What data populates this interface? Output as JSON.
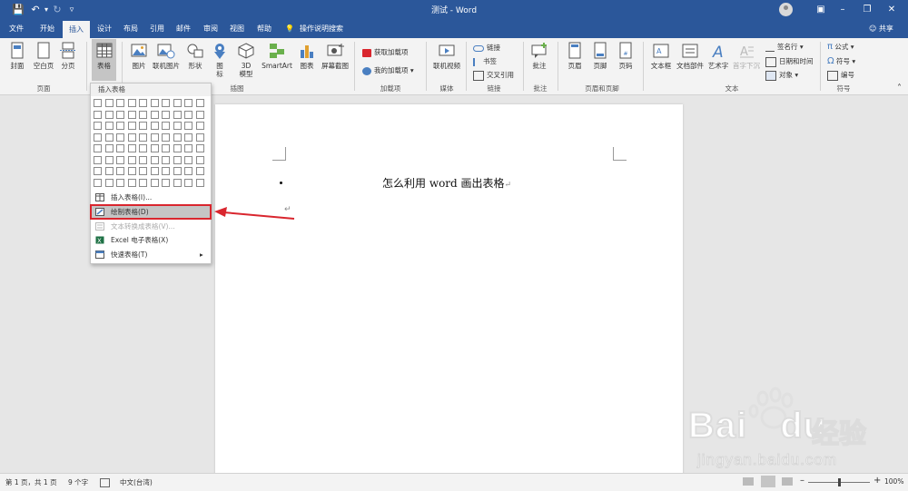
{
  "window": {
    "title": "测试 - Word",
    "share_label": "共享",
    "controls": {
      "ribbon_display": "▣",
      "minimize": "–",
      "restore": "❐",
      "close": "✕"
    }
  },
  "quick_access": {
    "save_icon": "💾",
    "undo_icon": "↶",
    "undo_dd": "▾",
    "redo_icon": "↻",
    "customize_icon": "▿"
  },
  "tabs": [
    "文件",
    "开始",
    "插入",
    "设计",
    "布局",
    "引用",
    "邮件",
    "审阅",
    "视图",
    "帮助"
  ],
  "tell_me": {
    "icon": "💡",
    "label": "操作说明搜索"
  },
  "ribbon": {
    "pages_group": {
      "label": "页面",
      "cover": "封面",
      "blank": "空白页",
      "break": "分页"
    },
    "table_group": {
      "label": "表格"
    },
    "illustrations_group": {
      "label": "插图",
      "picture": "图片",
      "online_picture": "联机图片",
      "shapes": "形状",
      "icons": "图标",
      "model3d": "3D 模型",
      "smartart": "SmartArt",
      "chart": "图表",
      "screenshot": "屏幕截图"
    },
    "addins_group": {
      "label": "加载项",
      "get": "获取加载项",
      "my": "我的加载项"
    },
    "media_group": {
      "label": "媒体",
      "video": "联机视频"
    },
    "links_group": {
      "label": "链接",
      "link": "链接",
      "bookmark": "书签",
      "crossref": "交叉引用"
    },
    "comments_group": {
      "label": "批注",
      "comment": "批注"
    },
    "headerfooter_group": {
      "label": "页眉和页脚",
      "header": "页眉",
      "footer": "页脚",
      "pagenum": "页码"
    },
    "text_group": {
      "label": "文本",
      "textbox": "文本框",
      "quickparts": "文档部件",
      "wordart": "艺术字",
      "dropcap": "首字下沉",
      "signature": "签名行",
      "datetime": "日期和时间",
      "object": "对象"
    },
    "symbols_group": {
      "label": "符号",
      "equation": "公式",
      "symbol": "符号",
      "number": "编号"
    },
    "collapse_icon": "˄"
  },
  "dropdown": {
    "header": "插入表格",
    "grid_cols": 10,
    "grid_rows": 8,
    "items": [
      {
        "label": "插入表格(I)...",
        "enabled": true,
        "highlight": false
      },
      {
        "label": "绘制表格(D)",
        "enabled": true,
        "highlight": true
      },
      {
        "label": "文本转换成表格(V)...",
        "enabled": false,
        "highlight": false
      },
      {
        "label": "Excel 电子表格(X)",
        "enabled": true,
        "highlight": false
      },
      {
        "label": "快速表格(T)",
        "enabled": true,
        "highlight": false,
        "submenu": "▸"
      }
    ]
  },
  "document": {
    "heading": "怎么利用 word 画出表格",
    "para_mark": "↵",
    "cursor_mark": "↵"
  },
  "status": {
    "page": "第 1 页，共 1 页",
    "words": "9 个字",
    "language": "中文(台湾)",
    "zoom": "100%",
    "zoom_minus": "–",
    "zoom_plus": "+",
    "zoom_level": 0.5
  },
  "watermark": {
    "brand": "Bai",
    "brand_tail": "du",
    "cn": "经验",
    "url": "jingyan.baidu.com"
  },
  "colors": {
    "word_blue": "#2b579a",
    "highlight_red": "#d9262e",
    "arrow_red": "#d9262e"
  }
}
